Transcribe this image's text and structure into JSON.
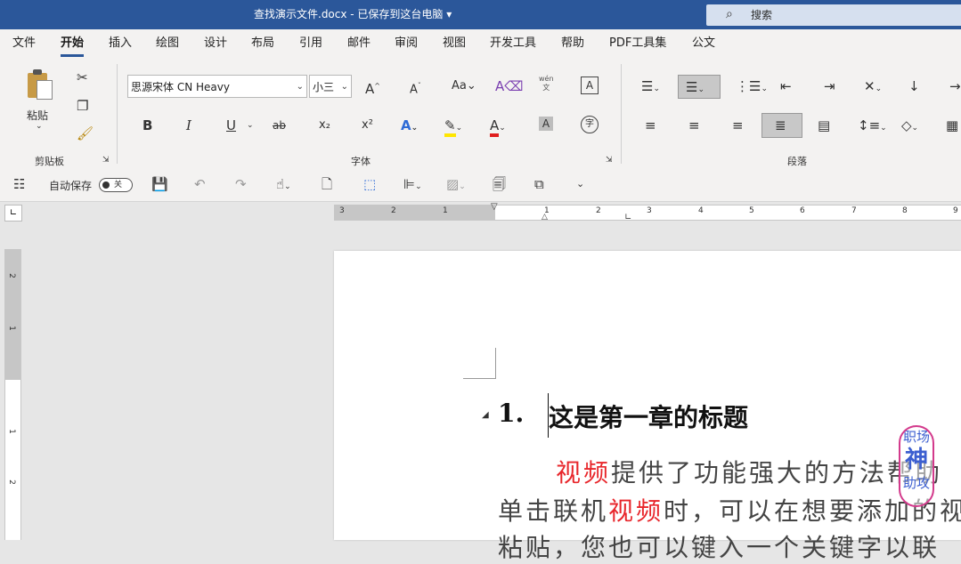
{
  "titlebar": {
    "title": "查找演示文件.docx  -  已保存到这台电脑  ▾",
    "search_placeholder": "搜索"
  },
  "menu": [
    "文件",
    "开始",
    "插入",
    "绘图",
    "设计",
    "布局",
    "引用",
    "邮件",
    "审阅",
    "视图",
    "开发工具",
    "帮助",
    "PDF工具集",
    "公文"
  ],
  "ribbon": {
    "clipboard": {
      "paste": "粘贴",
      "group": "剪贴板"
    },
    "font": {
      "name": "思源宋体 CN Heavy",
      "size": "小三",
      "group": "字体",
      "change_case": "Aa",
      "phonetic": "wén",
      "bold": "B",
      "italic": "I",
      "underline": "U",
      "strike": "ab",
      "subscript": "x₂",
      "superscript": "x²"
    },
    "paragraph": {
      "group": "段落"
    }
  },
  "qat": {
    "autosave_label": "自动保存",
    "autosave_state": "关"
  },
  "ruler": {
    "h_left": [
      "3",
      "2",
      "1"
    ],
    "h_right": [
      "1",
      "2",
      "3",
      "4",
      "5",
      "6",
      "7",
      "8",
      "9"
    ],
    "v": [
      "2",
      "1",
      "1",
      "2"
    ]
  },
  "document": {
    "heading_number": "1.",
    "heading_text": "这是第一章的标题",
    "line1": [
      {
        "t": "视频",
        "red": true
      },
      {
        "t": "提供了功能强大的方法帮助",
        "red": false
      }
    ],
    "line2": [
      {
        "t": "单击联机",
        "red": false
      },
      {
        "t": "视频",
        "red": true
      },
      {
        "t": "时，可以在想要添加的视",
        "red": false
      }
    ],
    "line3": [
      {
        "t": "粘贴，您也可以键入一个关键字以联",
        "red": false
      }
    ]
  },
  "watermark": {
    "line1": "职场",
    "line2": "神",
    "line3": "助攻"
  },
  "colors": {
    "accent": "#2b579a",
    "keyword": "#e8262b",
    "watermark_border": "#d33a8c"
  }
}
